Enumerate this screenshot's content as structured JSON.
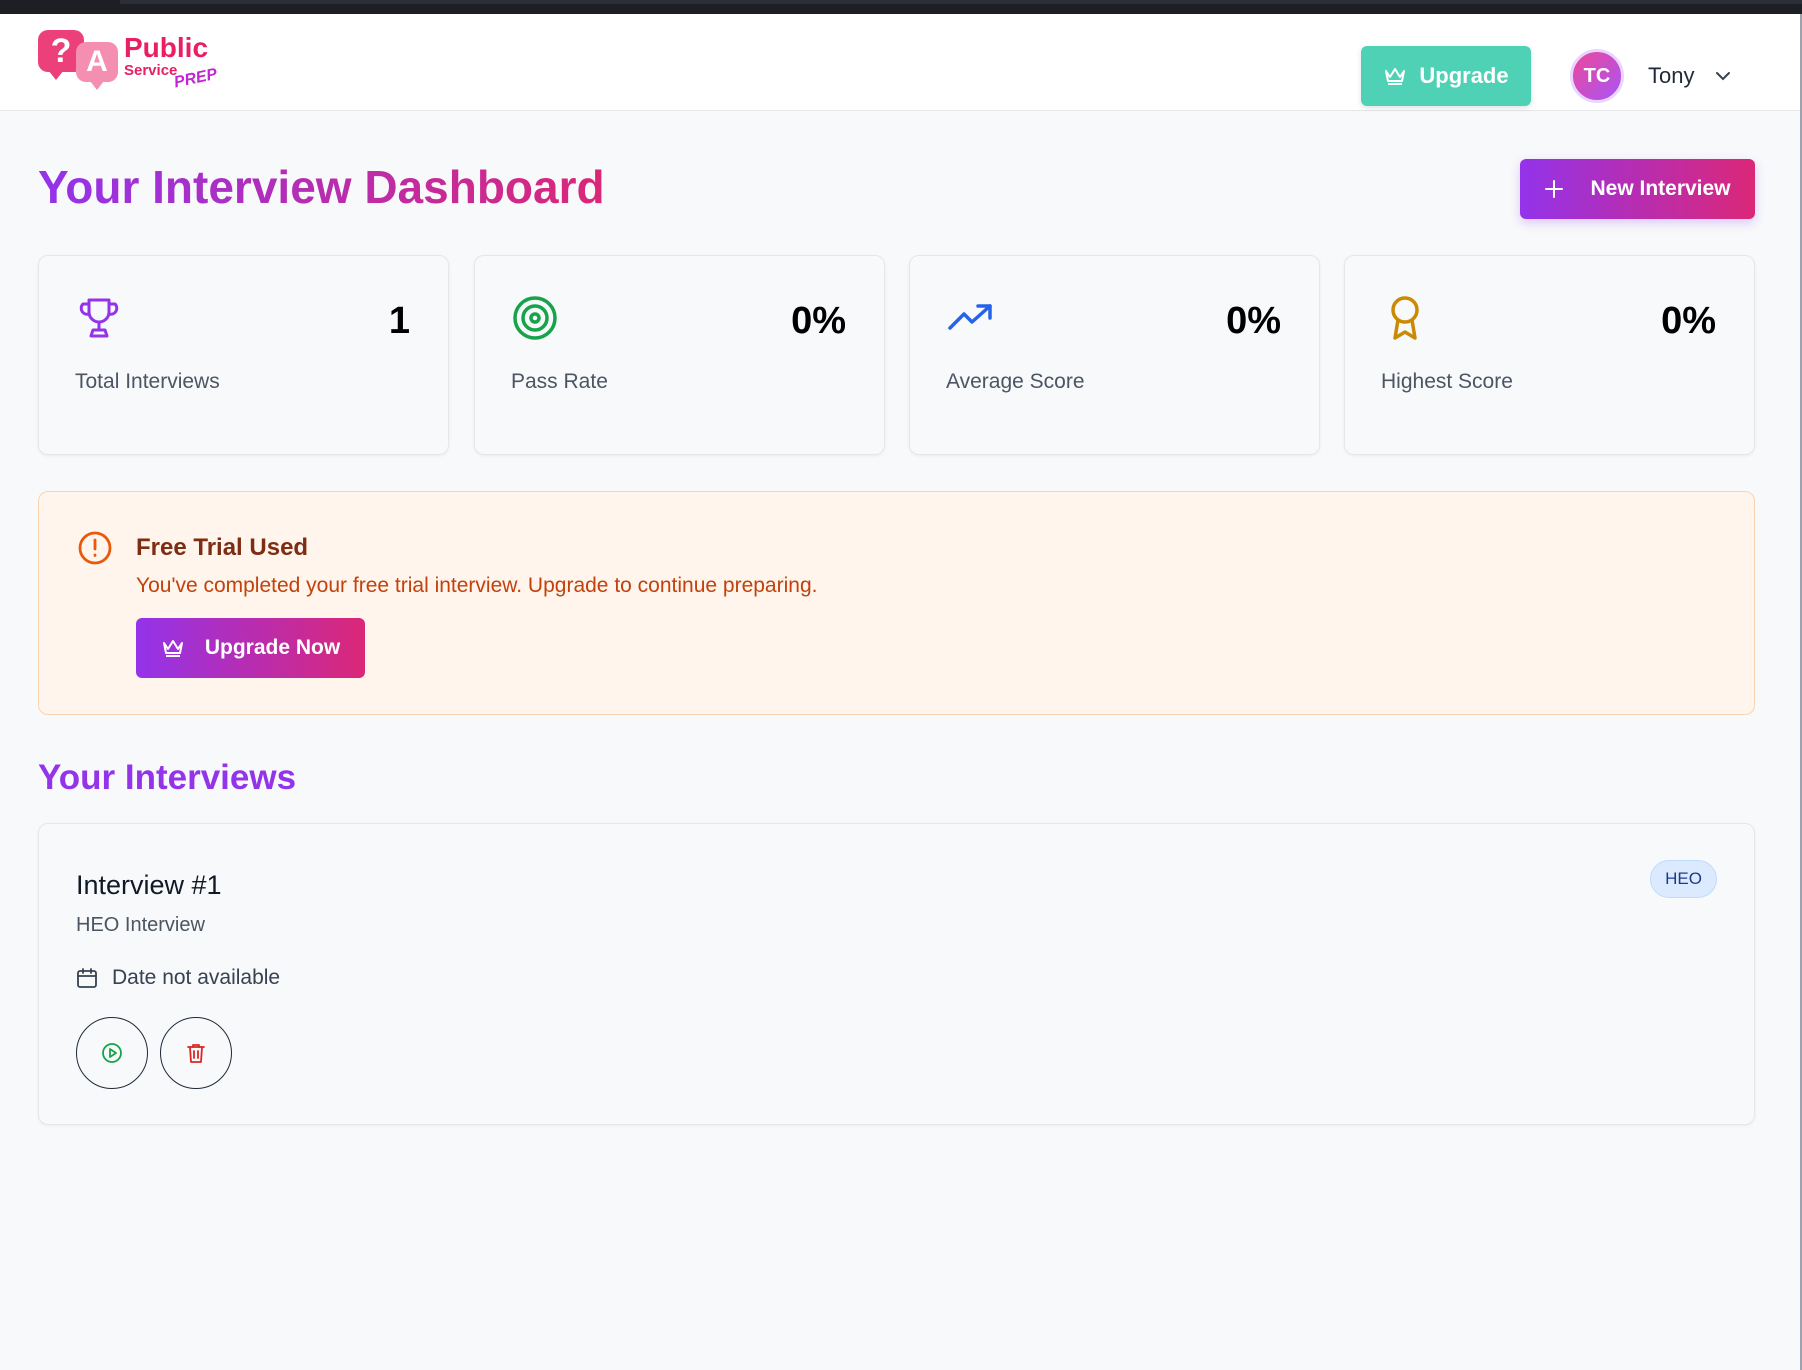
{
  "brand": {
    "logo_q": "?",
    "logo_a": "A",
    "word1": "Public",
    "word2": "Service",
    "word3": "PREP"
  },
  "header": {
    "upgrade_label": "Upgrade",
    "user_initials": "TC",
    "user_name": "Tony"
  },
  "main": {
    "title": "Your Interview Dashboard",
    "new_interview_label": "New Interview"
  },
  "stats": [
    {
      "label": "Total Interviews",
      "value": "1",
      "icon": "trophy-icon",
      "color": "#9333ea"
    },
    {
      "label": "Pass Rate",
      "value": "0%",
      "icon": "target-icon",
      "color": "#16a34a"
    },
    {
      "label": "Average Score",
      "value": "0%",
      "icon": "trending-up-icon",
      "color": "#2563eb"
    },
    {
      "label": "Highest Score",
      "value": "0%",
      "icon": "award-icon",
      "color": "#ca8a04"
    }
  ],
  "alert": {
    "title": "Free Trial Used",
    "message": "You've completed your free trial interview. Upgrade to continue preparing.",
    "button_label": "Upgrade Now"
  },
  "interviews": {
    "section_title": "Your Interviews",
    "items": [
      {
        "title": "Interview #1",
        "subtitle": "HEO Interview",
        "date": "Date not available",
        "badge": "HEO"
      }
    ]
  },
  "colors": {
    "accent_purple": "#9333ea",
    "accent_pink": "#db2777",
    "upgrade_teal": "#4fd1b5",
    "alert_bg": "#fff5ec"
  }
}
